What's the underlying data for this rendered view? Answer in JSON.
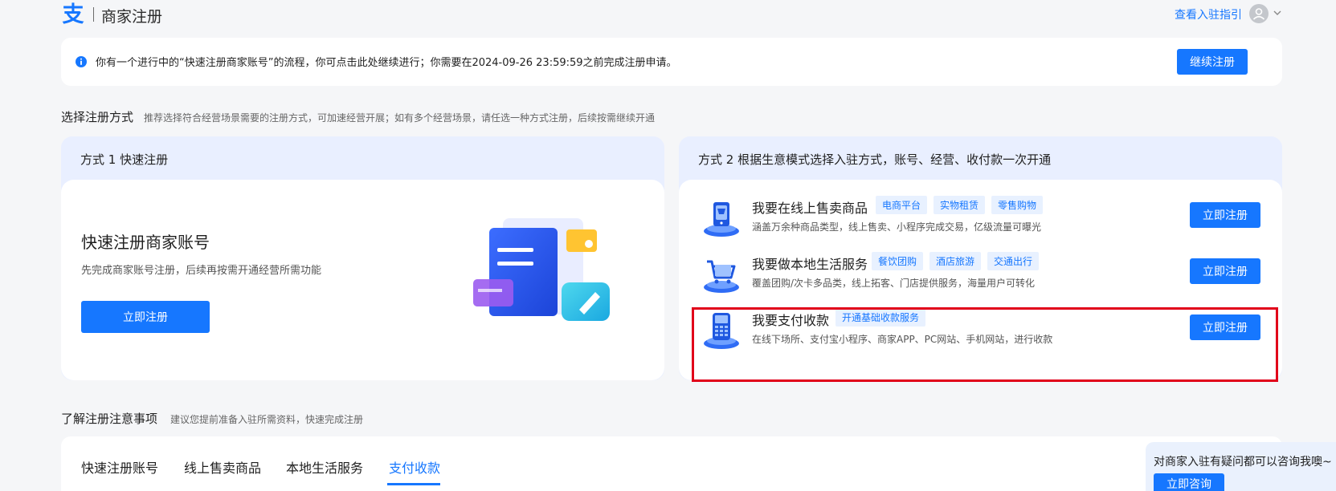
{
  "header": {
    "brand": "商家注册",
    "guide_link": "查看入驻指引"
  },
  "notice": {
    "text": "你有一个进行中的“快速注册商家账号”的流程，你可点击此处继续进行；你需要在2024-09-26 23:59:59之前完成注册申请。",
    "continue_label": "继续注册"
  },
  "section1": {
    "title": "选择注册方式",
    "subtitle": "推荐选择符合经营场景需要的注册方式，可加速经营开展；如有多个经营场景，请任选一种方式注册，后续按需继续开通"
  },
  "method1": {
    "header": "方式 1 快速注册",
    "title": "快速注册商家账号",
    "desc": "先完成商家账号注册，后续再按需开通经营所需功能",
    "button": "立即注册"
  },
  "method2": {
    "header": "方式 2 根据生意模式选择入驻方式，账号、经营、收付款一次开通",
    "rows": [
      {
        "title": "我要在线上售卖商品",
        "tags": [
          "电商平台",
          "实物租赁",
          "零售购物"
        ],
        "desc": "涵盖万余种商品类型，线上售卖、小程序完成交易，亿级流量可曝光",
        "button": "立即注册",
        "icon": "online-shop-icon"
      },
      {
        "title": "我要做本地生活服务",
        "tags": [
          "餐饮团购",
          "酒店旅游",
          "交通出行"
        ],
        "desc": "覆盖团购/次卡多品类，线上拓客、门店提供服务，海量用户可转化",
        "button": "立即注册",
        "icon": "shopping-cart-icon"
      },
      {
        "title": "我要支付收款",
        "tags": [
          "开通基础收款服务"
        ],
        "desc": "在线下场所、支付宝小程序、商家APP、PC网站、手机网站，进行收款",
        "button": "立即注册",
        "icon": "pos-terminal-icon"
      }
    ]
  },
  "section2": {
    "title": "了解注册注意事项",
    "subtitle": "建议您提前准备入驻所需资料，快速完成注册"
  },
  "tabs": [
    "快速注册账号",
    "线上售卖商品",
    "本地生活服务",
    "支付收款"
  ],
  "active_tab": "支付收款",
  "consult": {
    "text": "对商家入驻有疑问都可以咨询我噢~",
    "button": "立即咨询"
  },
  "colors": {
    "primary": "#1677ff",
    "highlight_border": "#e1001a",
    "card_header_bg": "#e9efff"
  }
}
